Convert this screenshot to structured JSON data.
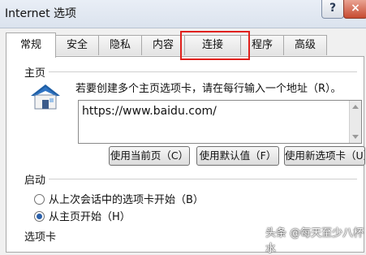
{
  "window": {
    "title": "Internet 选项",
    "help_label": "?",
    "close_label": "×"
  },
  "tabs": [
    {
      "label": "常规",
      "active": true
    },
    {
      "label": "安全",
      "active": false
    },
    {
      "label": "隐私",
      "active": false
    },
    {
      "label": "内容",
      "active": false
    },
    {
      "label": "连接",
      "active": false,
      "highlighted": true
    },
    {
      "label": "程序",
      "active": false
    },
    {
      "label": "高级",
      "active": false
    }
  ],
  "homepage": {
    "section_label": "主页",
    "description": "若要创建多个主页选项卡，请在每行输入一个地址（R）。",
    "url_value": "https://www.baidu.com/",
    "buttons": {
      "use_current": "使用当前页（C）",
      "use_default": "使用默认值（F）",
      "use_new_tab": "使用新选项卡（U）"
    }
  },
  "startup": {
    "section_label": "启动",
    "options": [
      {
        "label": "从上次会话中的选项卡开始（B）",
        "checked": false
      },
      {
        "label": "从主页开始（H）",
        "checked": true
      }
    ]
  },
  "tabs_section": {
    "section_label": "选项卡"
  },
  "watermark": "头条 @每天至少八杯水",
  "colors": {
    "highlight_box": "#e0201b",
    "close_button": "#c74b31"
  }
}
